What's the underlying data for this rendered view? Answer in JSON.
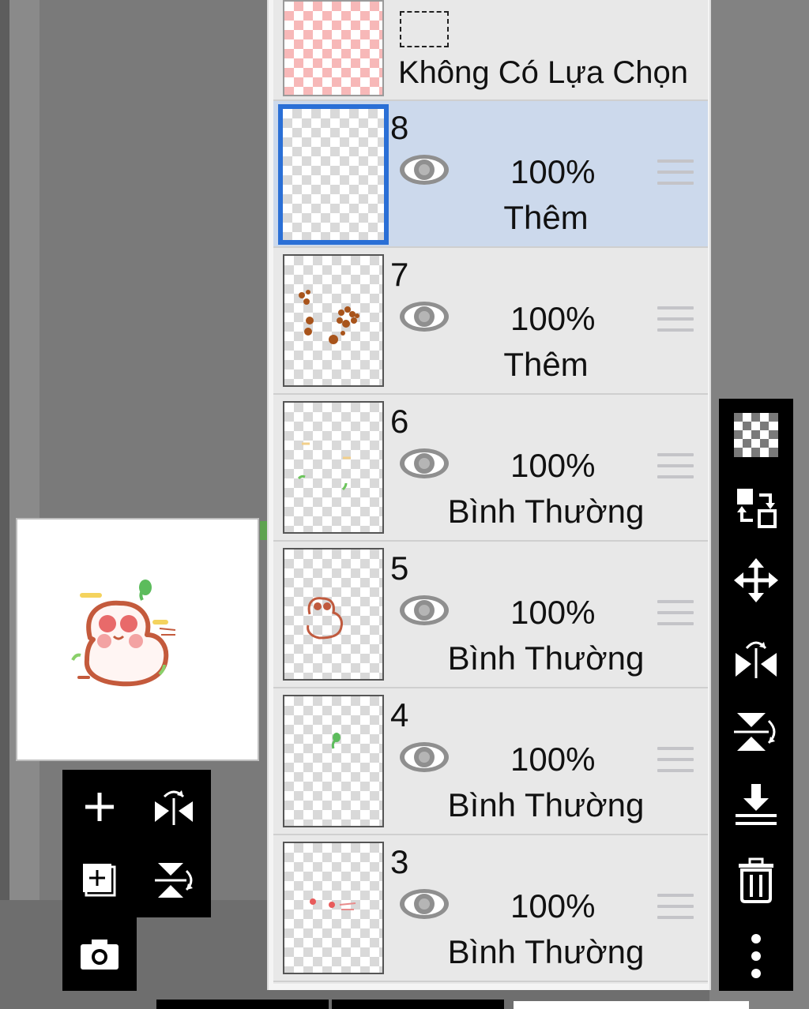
{
  "selection": {
    "label": "Không Có Lựa Chọn"
  },
  "layers": [
    {
      "number": "8",
      "opacity": "100%",
      "blend": "Thêm",
      "selected": true
    },
    {
      "number": "7",
      "opacity": "100%",
      "blend": "Thêm",
      "selected": false
    },
    {
      "number": "6",
      "opacity": "100%",
      "blend": "Bình Thường",
      "selected": false
    },
    {
      "number": "5",
      "opacity": "100%",
      "blend": "Bình Thường",
      "selected": false
    },
    {
      "number": "4",
      "opacity": "100%",
      "blend": "Bình Thường",
      "selected": false
    },
    {
      "number": "3",
      "opacity": "100%",
      "blend": "Bình Thường",
      "selected": false
    }
  ],
  "icons": {
    "left_toolbox": [
      "add-layer-icon",
      "flip-horizontal-icon",
      "add-layer-copy-icon",
      "flip-vertical-icon",
      "camera-icon"
    ],
    "right_toolbox": [
      "transparency-icon",
      "swap-layer-icon",
      "move-icon",
      "flip-horizontal-icon",
      "flip-vertical-icon",
      "merge-down-icon",
      "trash-icon",
      "more-icon"
    ]
  },
  "colors": {
    "selected_row": "#ccd9ec",
    "selected_border": "#2a6fd6",
    "toolbox": "#000000"
  }
}
